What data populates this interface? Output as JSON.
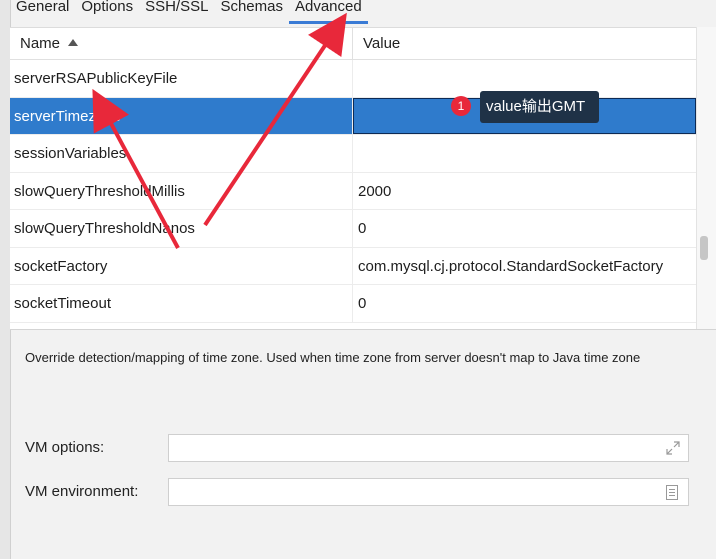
{
  "tabs": [
    {
      "label": "General",
      "active": false
    },
    {
      "label": "Options",
      "active": false
    },
    {
      "label": "SSH/SSL",
      "active": false
    },
    {
      "label": "Schemas",
      "active": false
    },
    {
      "label": "Advanced",
      "active": true
    }
  ],
  "table": {
    "columns": {
      "name": "Name",
      "value": "Value"
    },
    "rows": [
      {
        "name": "serverRSAPublicKeyFile",
        "value": ""
      },
      {
        "name": "serverTimezone",
        "value": "",
        "selected": true
      },
      {
        "name": "sessionVariables",
        "value": ""
      },
      {
        "name": "slowQueryThresholdMillis",
        "value": "2000"
      },
      {
        "name": "slowQueryThresholdNanos",
        "value": "0"
      },
      {
        "name": "socketFactory",
        "value": "com.mysql.cj.protocol.StandardSocketFactory"
      },
      {
        "name": "socketTimeout",
        "value": "0"
      }
    ]
  },
  "description": "Override detection/mapping of time zone. Used when time zone from server doesn't map to Java time zone",
  "form": {
    "vm_options_label": "VM options:",
    "vm_options_value": "",
    "vm_environment_label": "VM environment:",
    "vm_environment_value": ""
  },
  "annotation": {
    "badge": "1",
    "tooltip": "value输出GMT"
  },
  "colors": {
    "selection": "#2f7bcc",
    "tooltip_bg": "#1f3247",
    "badge": "#e8283a",
    "arrow": "#e8283a",
    "active_tab_underline": "#3a7bd5"
  }
}
